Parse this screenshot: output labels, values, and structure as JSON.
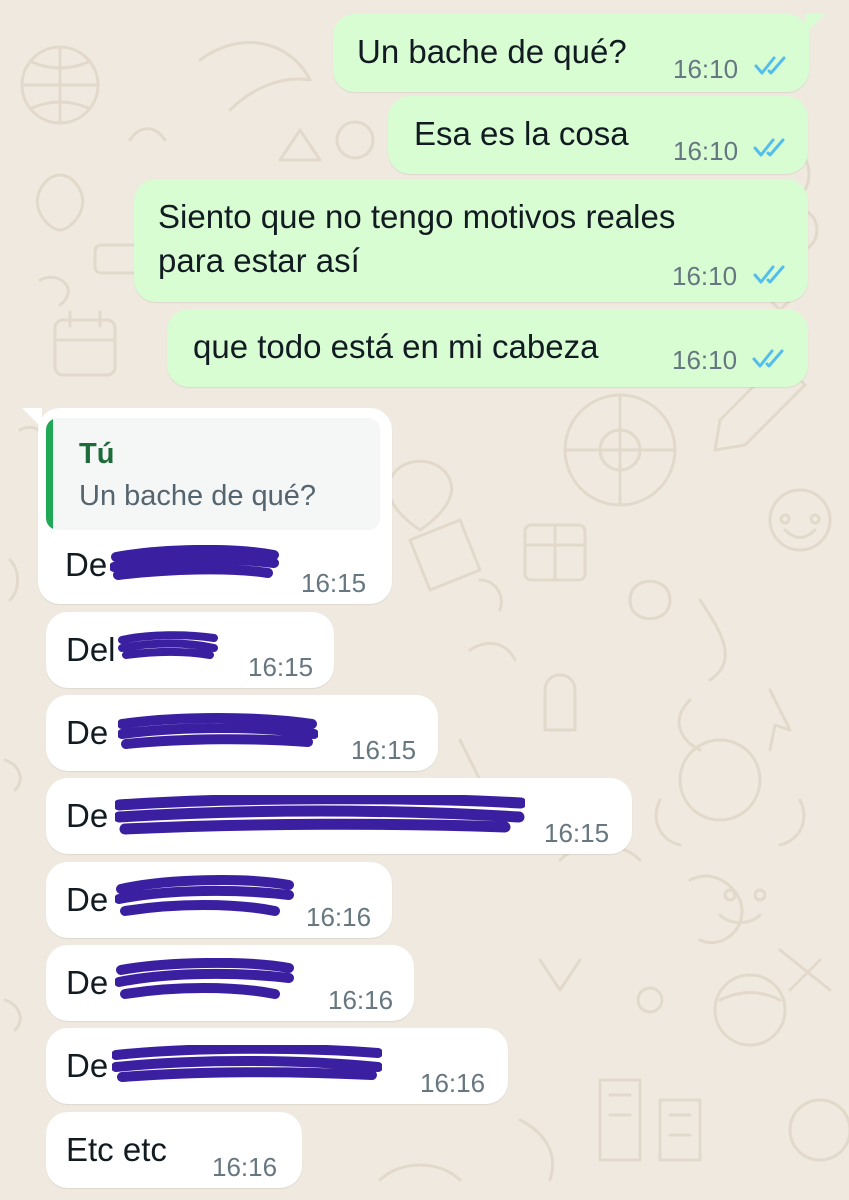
{
  "messages_outgoing": [
    {
      "text": "Un bache de qué?",
      "time": "16:10",
      "status": "read"
    },
    {
      "text": "Esa es la cosa",
      "time": "16:10",
      "status": "read"
    },
    {
      "line1": "Siento que no tengo motivos reales",
      "line2": "para estar así",
      "time": "16:10",
      "status": "read"
    },
    {
      "text": "que todo está en mi cabeza",
      "time": "16:10",
      "status": "read"
    }
  ],
  "reply_quote": {
    "author": "Tú",
    "text": "Un bache de qué?"
  },
  "messages_incoming": [
    {
      "text": "De",
      "time": "16:15"
    },
    {
      "text": "Del",
      "time": "16:15"
    },
    {
      "text": "De",
      "time": "16:15"
    },
    {
      "text": "De",
      "time": "16:15"
    },
    {
      "text": "De",
      "time": "16:16"
    },
    {
      "text": "De",
      "time": "16:16"
    },
    {
      "text": "De",
      "time": "16:16"
    },
    {
      "text": "Etc etc",
      "time": "16:16"
    }
  ],
  "colors": {
    "outgoing_bubble": "#d9fdd3",
    "incoming_bubble": "#ffffff",
    "read_ticks": "#53bdeb",
    "redaction": "#3a1fa0",
    "quote_accent": "#1fa855"
  },
  "icons": [
    "double-check-icon"
  ]
}
